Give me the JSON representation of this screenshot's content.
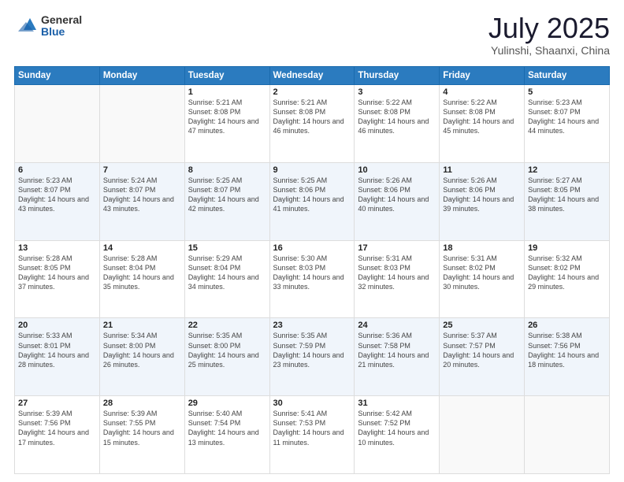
{
  "header": {
    "logo_general": "General",
    "logo_blue": "Blue",
    "title": "July 2025",
    "subtitle": "Yulinshi, Shaanxi, China"
  },
  "days_of_week": [
    "Sunday",
    "Monday",
    "Tuesday",
    "Wednesday",
    "Thursday",
    "Friday",
    "Saturday"
  ],
  "weeks": [
    [
      {
        "day": "",
        "sunrise": "",
        "sunset": "",
        "daylight": ""
      },
      {
        "day": "",
        "sunrise": "",
        "sunset": "",
        "daylight": ""
      },
      {
        "day": "1",
        "sunrise": "Sunrise: 5:21 AM",
        "sunset": "Sunset: 8:08 PM",
        "daylight": "Daylight: 14 hours and 47 minutes."
      },
      {
        "day": "2",
        "sunrise": "Sunrise: 5:21 AM",
        "sunset": "Sunset: 8:08 PM",
        "daylight": "Daylight: 14 hours and 46 minutes."
      },
      {
        "day": "3",
        "sunrise": "Sunrise: 5:22 AM",
        "sunset": "Sunset: 8:08 PM",
        "daylight": "Daylight: 14 hours and 46 minutes."
      },
      {
        "day": "4",
        "sunrise": "Sunrise: 5:22 AM",
        "sunset": "Sunset: 8:08 PM",
        "daylight": "Daylight: 14 hours and 45 minutes."
      },
      {
        "day": "5",
        "sunrise": "Sunrise: 5:23 AM",
        "sunset": "Sunset: 8:07 PM",
        "daylight": "Daylight: 14 hours and 44 minutes."
      }
    ],
    [
      {
        "day": "6",
        "sunrise": "Sunrise: 5:23 AM",
        "sunset": "Sunset: 8:07 PM",
        "daylight": "Daylight: 14 hours and 43 minutes."
      },
      {
        "day": "7",
        "sunrise": "Sunrise: 5:24 AM",
        "sunset": "Sunset: 8:07 PM",
        "daylight": "Daylight: 14 hours and 43 minutes."
      },
      {
        "day": "8",
        "sunrise": "Sunrise: 5:25 AM",
        "sunset": "Sunset: 8:07 PM",
        "daylight": "Daylight: 14 hours and 42 minutes."
      },
      {
        "day": "9",
        "sunrise": "Sunrise: 5:25 AM",
        "sunset": "Sunset: 8:06 PM",
        "daylight": "Daylight: 14 hours and 41 minutes."
      },
      {
        "day": "10",
        "sunrise": "Sunrise: 5:26 AM",
        "sunset": "Sunset: 8:06 PM",
        "daylight": "Daylight: 14 hours and 40 minutes."
      },
      {
        "day": "11",
        "sunrise": "Sunrise: 5:26 AM",
        "sunset": "Sunset: 8:06 PM",
        "daylight": "Daylight: 14 hours and 39 minutes."
      },
      {
        "day": "12",
        "sunrise": "Sunrise: 5:27 AM",
        "sunset": "Sunset: 8:05 PM",
        "daylight": "Daylight: 14 hours and 38 minutes."
      }
    ],
    [
      {
        "day": "13",
        "sunrise": "Sunrise: 5:28 AM",
        "sunset": "Sunset: 8:05 PM",
        "daylight": "Daylight: 14 hours and 37 minutes."
      },
      {
        "day": "14",
        "sunrise": "Sunrise: 5:28 AM",
        "sunset": "Sunset: 8:04 PM",
        "daylight": "Daylight: 14 hours and 35 minutes."
      },
      {
        "day": "15",
        "sunrise": "Sunrise: 5:29 AM",
        "sunset": "Sunset: 8:04 PM",
        "daylight": "Daylight: 14 hours and 34 minutes."
      },
      {
        "day": "16",
        "sunrise": "Sunrise: 5:30 AM",
        "sunset": "Sunset: 8:03 PM",
        "daylight": "Daylight: 14 hours and 33 minutes."
      },
      {
        "day": "17",
        "sunrise": "Sunrise: 5:31 AM",
        "sunset": "Sunset: 8:03 PM",
        "daylight": "Daylight: 14 hours and 32 minutes."
      },
      {
        "day": "18",
        "sunrise": "Sunrise: 5:31 AM",
        "sunset": "Sunset: 8:02 PM",
        "daylight": "Daylight: 14 hours and 30 minutes."
      },
      {
        "day": "19",
        "sunrise": "Sunrise: 5:32 AM",
        "sunset": "Sunset: 8:02 PM",
        "daylight": "Daylight: 14 hours and 29 minutes."
      }
    ],
    [
      {
        "day": "20",
        "sunrise": "Sunrise: 5:33 AM",
        "sunset": "Sunset: 8:01 PM",
        "daylight": "Daylight: 14 hours and 28 minutes."
      },
      {
        "day": "21",
        "sunrise": "Sunrise: 5:34 AM",
        "sunset": "Sunset: 8:00 PM",
        "daylight": "Daylight: 14 hours and 26 minutes."
      },
      {
        "day": "22",
        "sunrise": "Sunrise: 5:35 AM",
        "sunset": "Sunset: 8:00 PM",
        "daylight": "Daylight: 14 hours and 25 minutes."
      },
      {
        "day": "23",
        "sunrise": "Sunrise: 5:35 AM",
        "sunset": "Sunset: 7:59 PM",
        "daylight": "Daylight: 14 hours and 23 minutes."
      },
      {
        "day": "24",
        "sunrise": "Sunrise: 5:36 AM",
        "sunset": "Sunset: 7:58 PM",
        "daylight": "Daylight: 14 hours and 21 minutes."
      },
      {
        "day": "25",
        "sunrise": "Sunrise: 5:37 AM",
        "sunset": "Sunset: 7:57 PM",
        "daylight": "Daylight: 14 hours and 20 minutes."
      },
      {
        "day": "26",
        "sunrise": "Sunrise: 5:38 AM",
        "sunset": "Sunset: 7:56 PM",
        "daylight": "Daylight: 14 hours and 18 minutes."
      }
    ],
    [
      {
        "day": "27",
        "sunrise": "Sunrise: 5:39 AM",
        "sunset": "Sunset: 7:56 PM",
        "daylight": "Daylight: 14 hours and 17 minutes."
      },
      {
        "day": "28",
        "sunrise": "Sunrise: 5:39 AM",
        "sunset": "Sunset: 7:55 PM",
        "daylight": "Daylight: 14 hours and 15 minutes."
      },
      {
        "day": "29",
        "sunrise": "Sunrise: 5:40 AM",
        "sunset": "Sunset: 7:54 PM",
        "daylight": "Daylight: 14 hours and 13 minutes."
      },
      {
        "day": "30",
        "sunrise": "Sunrise: 5:41 AM",
        "sunset": "Sunset: 7:53 PM",
        "daylight": "Daylight: 14 hours and 11 minutes."
      },
      {
        "day": "31",
        "sunrise": "Sunrise: 5:42 AM",
        "sunset": "Sunset: 7:52 PM",
        "daylight": "Daylight: 14 hours and 10 minutes."
      },
      {
        "day": "",
        "sunrise": "",
        "sunset": "",
        "daylight": ""
      },
      {
        "day": "",
        "sunrise": "",
        "sunset": "",
        "daylight": ""
      }
    ]
  ]
}
